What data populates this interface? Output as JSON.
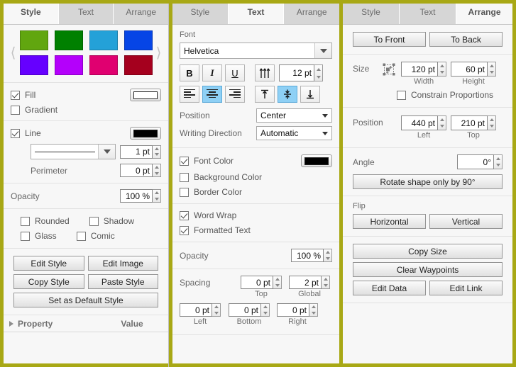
{
  "panels": {
    "style": {
      "tabs": [
        {
          "label": "Style",
          "active": true
        },
        {
          "label": "Text",
          "active": false
        },
        {
          "label": "Arrange",
          "active": false
        }
      ],
      "palette": {
        "prev_icon": "chevron-left",
        "next_icon": "chevron-right",
        "colors": [
          "#61a60f",
          "#008000",
          "#24a1d8",
          "#0645e6",
          "#6600ff",
          "#b400fb",
          "#e00070",
          "#a5001e"
        ]
      },
      "fill": {
        "label": "Fill",
        "checked": true,
        "color": "#ffffff"
      },
      "gradient": {
        "label": "Gradient",
        "checked": false
      },
      "line": {
        "label": "Line",
        "checked": true,
        "color": "#000000",
        "style_value": "solid-line",
        "width_value": "1 pt"
      },
      "perimeter": {
        "label": "Perimeter",
        "value": "0 pt"
      },
      "opacity": {
        "label": "Opacity",
        "value": "100 %"
      },
      "toggles": [
        {
          "label": "Rounded",
          "checked": false
        },
        {
          "label": "Shadow",
          "checked": false
        },
        {
          "label": "Glass",
          "checked": false
        },
        {
          "label": "Comic",
          "checked": false
        }
      ],
      "buttons": {
        "edit_style": "Edit Style",
        "edit_image": "Edit Image",
        "copy_style": "Copy Style",
        "paste_style": "Paste Style",
        "set_default": "Set as Default Style"
      },
      "property_grid": {
        "property_header": "Property",
        "value_header": "Value"
      }
    },
    "text": {
      "tabs": [
        {
          "label": "Style",
          "active": false
        },
        {
          "label": "Text",
          "active": true
        },
        {
          "label": "Arrange",
          "active": false
        }
      ],
      "font": {
        "section_label": "Font",
        "family": "Helvetica",
        "bold": "B",
        "italic": "I",
        "underline": "U",
        "line_height_icon": "line-height-icon",
        "size": "12 pt",
        "align_left_icon": "align-left-icon",
        "align_center_icon": "align-center-icon",
        "align_right_icon": "align-right-icon",
        "valign_top_icon": "align-top-icon",
        "valign_middle_icon": "align-middle-icon",
        "valign_bottom_icon": "align-bottom-icon",
        "align_active": "center",
        "valign_active": "middle"
      },
      "position": {
        "label": "Position",
        "value": "Center"
      },
      "writing_direction": {
        "label": "Writing Direction",
        "value": "Automatic"
      },
      "font_color": {
        "label": "Font Color",
        "checked": true,
        "color": "#000000"
      },
      "background_color": {
        "label": "Background Color",
        "checked": false
      },
      "border_color": {
        "label": "Border Color",
        "checked": false
      },
      "word_wrap": {
        "label": "Word Wrap",
        "checked": true
      },
      "formatted_text": {
        "label": "Formatted Text",
        "checked": true
      },
      "opacity": {
        "label": "Opacity",
        "value": "100 %"
      },
      "spacing": {
        "label": "Spacing",
        "top": {
          "value": "0 pt",
          "label": "Top"
        },
        "global": {
          "value": "2 pt",
          "label": "Global"
        },
        "left": {
          "value": "0 pt",
          "label": "Left"
        },
        "bottom": {
          "value": "0 pt",
          "label": "Bottom"
        },
        "right": {
          "value": "0 pt",
          "label": "Right"
        }
      }
    },
    "arrange": {
      "tabs": [
        {
          "label": "Style",
          "active": false
        },
        {
          "label": "Text",
          "active": false
        },
        {
          "label": "Arrange",
          "active": true
        }
      ],
      "order": {
        "to_front": "To Front",
        "to_back": "To Back"
      },
      "size": {
        "label": "Size",
        "autosize_icon": "autosize-icon",
        "width": {
          "value": "120 pt",
          "label": "Width"
        },
        "height": {
          "value": "60 pt",
          "label": "Height"
        },
        "constrain": {
          "label": "Constrain Proportions",
          "checked": false
        }
      },
      "position": {
        "label": "Position",
        "left": {
          "value": "440 pt",
          "label": "Left"
        },
        "top": {
          "value": "210 pt",
          "label": "Top"
        }
      },
      "angle": {
        "label": "Angle",
        "value": "0°",
        "rotate_button": "Rotate shape only by 90°"
      },
      "flip": {
        "label": "Flip",
        "horizontal": "Horizontal",
        "vertical": "Vertical"
      },
      "actions": {
        "copy_size": "Copy Size",
        "clear_waypoints": "Clear Waypoints",
        "edit_data": "Edit Data",
        "edit_link": "Edit Link"
      }
    }
  },
  "theme": {
    "frame_color": "#a8a815",
    "panel_bg": "#f7f7f7",
    "tab_bg": "#d6d6d6",
    "highlight": "#8ed0f5"
  }
}
